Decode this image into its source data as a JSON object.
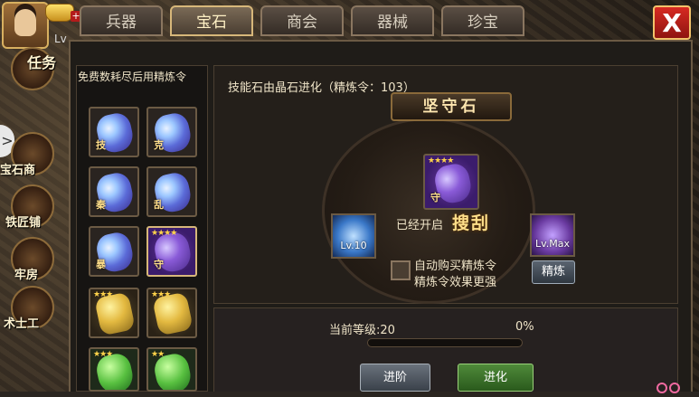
{
  "player": {
    "level_prefix": "Lv"
  },
  "side_menu": [
    {
      "label": "任务"
    },
    {
      "label": "宝石商"
    },
    {
      "label": "铁匠铺"
    },
    {
      "label": "牢房"
    },
    {
      "label": "术士工"
    }
  ],
  "tabs": [
    {
      "label": "兵器",
      "active": false
    },
    {
      "label": "宝石",
      "active": true
    },
    {
      "label": "商会",
      "active": false
    },
    {
      "label": "器械",
      "active": false
    },
    {
      "label": "珍宝",
      "active": false
    }
  ],
  "close_label": "X",
  "left_panel": {
    "hint": "免费数耗尽后用精炼令",
    "gems": [
      {
        "glyph": "技",
        "kind": "blue",
        "stars": ""
      },
      {
        "glyph": "克",
        "kind": "blue",
        "stars": ""
      },
      {
        "glyph": "秦",
        "kind": "blue",
        "stars": ""
      },
      {
        "glyph": "乱",
        "kind": "blue",
        "stars": ""
      },
      {
        "glyph": "暴",
        "kind": "blue",
        "stars": ""
      },
      {
        "glyph": "守",
        "kind": "purple",
        "stars": "★★★★",
        "selected": true
      },
      {
        "glyph": "",
        "kind": "gold",
        "stars": "★★★"
      },
      {
        "glyph": "",
        "kind": "gold",
        "stars": "★★★"
      },
      {
        "glyph": "",
        "kind": "green",
        "stars": "★★★"
      },
      {
        "glyph": "",
        "kind": "green",
        "stars": "★★"
      }
    ]
  },
  "detail": {
    "description": "技能石由晶石进化（精炼令：103）",
    "gem_name": "坚守石",
    "main_gem_glyph": "守",
    "main_gem_stars": "★★★★",
    "left_gem_level": "Lv.10",
    "right_gem_level": "Lv.Max",
    "opened_label": "已经开启",
    "opened_skill": "搜刮",
    "auto_buy_line1": "自动购买精炼令",
    "auto_buy_line2": "精炼令效果更强",
    "refine_button": "精炼"
  },
  "bottom": {
    "level_text": "当前等级:20",
    "percent_text": "0%",
    "progress": 0,
    "advance_button": "进阶",
    "evolve_button": "进化"
  }
}
